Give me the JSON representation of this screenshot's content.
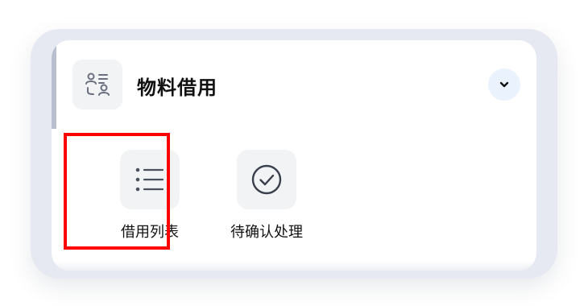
{
  "section": {
    "title": "物料借用",
    "header_icon": "user-list-icon",
    "collapse_icon": "chevron-down-icon"
  },
  "actions": [
    {
      "label": "借用列表",
      "icon": "list-icon",
      "highlighted": true
    },
    {
      "label": "待确认处理",
      "icon": "check-circle-icon",
      "highlighted": false
    }
  ],
  "colors": {
    "highlight": "#ff0000",
    "icon_bg": "#f2f3f5",
    "collapse_bg": "#eaf2fd",
    "frame_bg": "#e6e9f1",
    "text": "#111111"
  }
}
